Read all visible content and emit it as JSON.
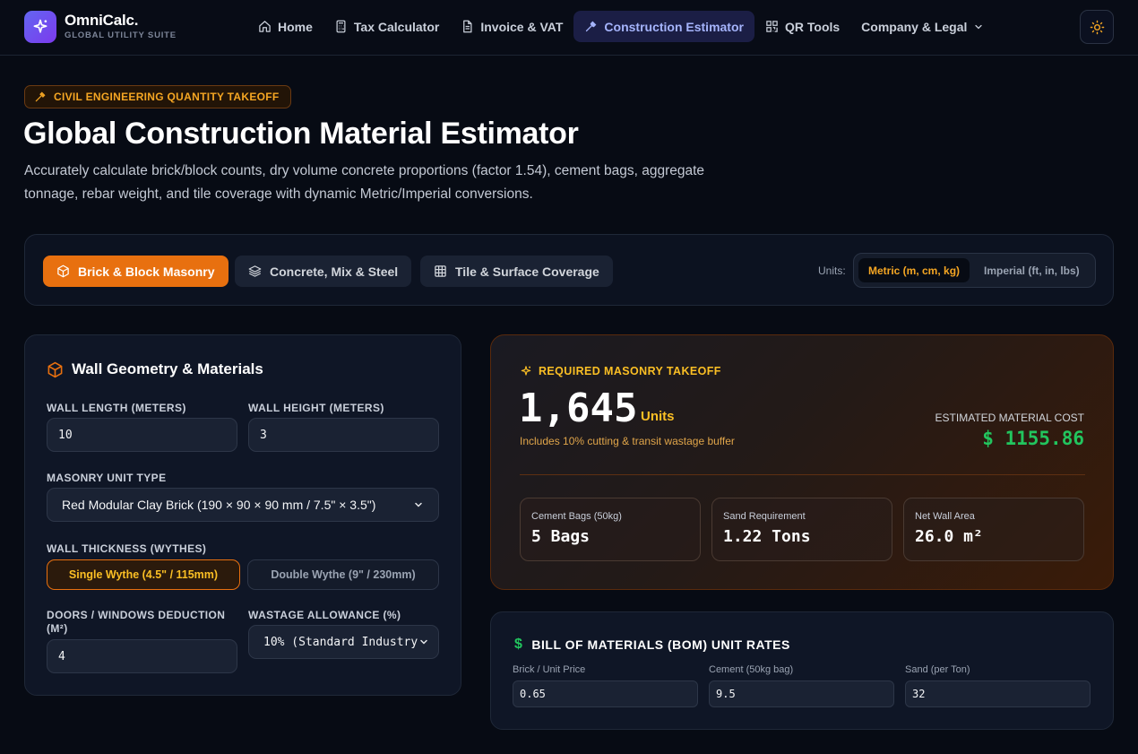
{
  "header": {
    "brand_name": "OmniCalc.",
    "brand_sub": "GLOBAL UTILITY SUITE",
    "nav": [
      {
        "label": "Home",
        "icon": "home-icon"
      },
      {
        "label": "Tax Calculator",
        "icon": "calculator-icon"
      },
      {
        "label": "Invoice & VAT",
        "icon": "document-icon"
      },
      {
        "label": "Construction Estimator",
        "icon": "hammer-icon",
        "active": true
      },
      {
        "label": "QR Tools",
        "icon": "qr-icon"
      },
      {
        "label": "Company & Legal",
        "icon": "chevron-down-icon"
      }
    ],
    "theme_icon": "sun-icon"
  },
  "hero": {
    "badge": "CIVIL ENGINEERING QUANTITY TAKEOFF",
    "title": "Global Construction Material Estimator",
    "description": "Accurately calculate brick/block counts, dry volume concrete proportions (factor 1.54), cement bags, aggregate tonnage, rebar weight, and tile coverage with dynamic Metric/Imperial conversions."
  },
  "tabs": [
    {
      "label": "Brick & Block Masonry",
      "icon": "cube-icon",
      "active": true
    },
    {
      "label": "Concrete, Mix & Steel",
      "icon": "layers-icon"
    },
    {
      "label": "Tile & Surface Coverage",
      "icon": "grid-icon"
    }
  ],
  "units": {
    "label": "Units:",
    "metric": "Metric (m, cm, kg)",
    "imperial": "Imperial (ft, in, lbs)",
    "selected": "metric"
  },
  "form": {
    "title": "Wall Geometry & Materials",
    "wall_length_label": "WALL LENGTH (METERS)",
    "wall_length_value": "10",
    "wall_height_label": "WALL HEIGHT (METERS)",
    "wall_height_value": "3",
    "masonry_label": "MASONRY UNIT TYPE",
    "masonry_value": "Red Modular Clay Brick (190 × 90 × 90 mm / 7.5\" × 3.5\")",
    "thickness_label": "WALL THICKNESS (WYTHES)",
    "thickness_single": "Single Wythe (4.5\" / 115mm)",
    "thickness_double": "Double Wythe (9\" / 230mm)",
    "deduction_label_line1": "DOORS / WINDOWS DEDUCTION",
    "deduction_label_line2": "(M²)",
    "deduction_value": "4",
    "wastage_label": "WASTAGE ALLOWANCE (%)",
    "wastage_value": "10% (Standard Industry"
  },
  "result": {
    "kicker": "REQUIRED MASONRY TAKEOFF",
    "count": "1,645",
    "count_unit": "Units",
    "note": "Includes 10% cutting & transit wastage buffer",
    "cost_label": "ESTIMATED MATERIAL COST",
    "cost_value": "$ 1155.86",
    "stats": [
      {
        "label": "Cement Bags (50kg)",
        "value": "5 Bags"
      },
      {
        "label": "Sand Requirement",
        "value": "1.22 Tons"
      },
      {
        "label": "Net Wall Area",
        "value": "26.0 m²"
      }
    ]
  },
  "bom": {
    "title": "BILL OF MATERIALS (BOM) UNIT RATES",
    "fields": [
      {
        "label": "Brick / Unit Price",
        "value": "0.65"
      },
      {
        "label": "Cement (50kg bag)",
        "value": "9.5"
      },
      {
        "label": "Sand (per Ton)",
        "value": "32"
      }
    ]
  },
  "colors": {
    "accent_orange": "#e8700f",
    "accent_amber": "#fbbf24",
    "accent_indigo": "#6366f1",
    "success_green": "#22c55e",
    "background": "#070b14"
  }
}
